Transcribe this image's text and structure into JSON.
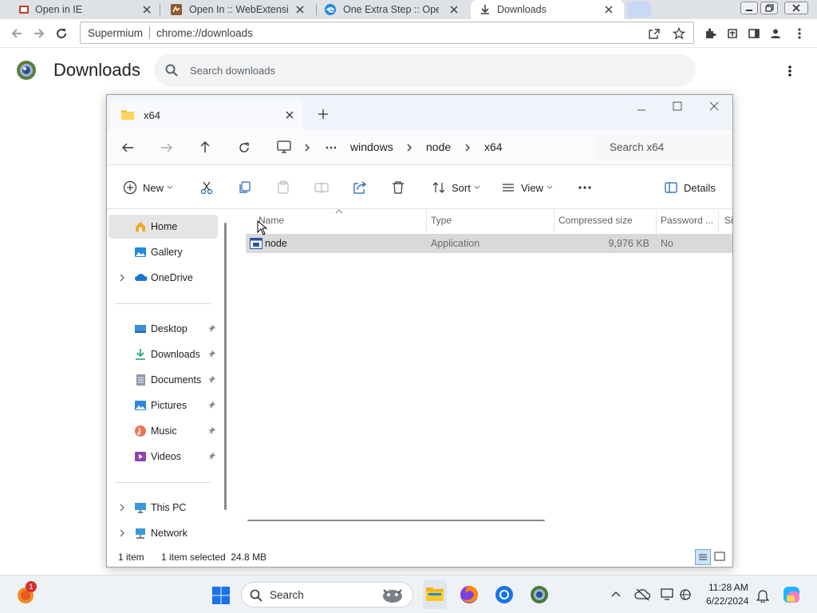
{
  "browser": {
    "tabs": [
      {
        "title": "Open in IE",
        "icon": "ie-extension-icon"
      },
      {
        "title": "Open In :: WebExtensions",
        "icon": "addon-icon"
      },
      {
        "title": "One Extra Step :: Open",
        "icon": "edge-icon"
      },
      {
        "title": "Downloads",
        "icon": "download-icon"
      }
    ],
    "omnibox": {
      "site_label": "Supermium",
      "url": "chrome://downloads"
    }
  },
  "downloads_page": {
    "title": "Downloads",
    "search_placeholder": "Search downloads"
  },
  "explorer": {
    "tab_title": "x64",
    "breadcrumb": [
      "windows",
      "node",
      "x64"
    ],
    "search_placeholder": "Search x64",
    "commands": {
      "new": "New",
      "sort": "Sort",
      "view": "View",
      "details": "Details"
    },
    "nav": {
      "top": [
        {
          "label": "Home",
          "icon": "home-icon",
          "selected": true
        },
        {
          "label": "Gallery",
          "icon": "gallery-icon"
        },
        {
          "label": "OneDrive",
          "icon": "onedrive-icon"
        }
      ],
      "quick": [
        {
          "label": "Desktop",
          "icon": "desktop-icon"
        },
        {
          "label": "Downloads",
          "icon": "downloads-folder-icon"
        },
        {
          "label": "Documents",
          "icon": "documents-icon"
        },
        {
          "label": "Pictures",
          "icon": "pictures-icon"
        },
        {
          "label": "Music",
          "icon": "music-icon"
        },
        {
          "label": "Videos",
          "icon": "videos-icon"
        }
      ],
      "bottom": [
        {
          "label": "This PC",
          "icon": "this-pc-icon"
        },
        {
          "label": "Network",
          "icon": "network-icon"
        }
      ]
    },
    "columns": [
      "Name",
      "Type",
      "Compressed size",
      "Password ...",
      "Si"
    ],
    "files": [
      {
        "name": "node",
        "type": "Application",
        "compressed_size": "9,976 KB",
        "password": "No"
      }
    ],
    "status": {
      "count": "1 item",
      "selected": "1 item selected  24.8 MB"
    }
  },
  "taskbar": {
    "search_label": "Search",
    "time": "11:28 AM",
    "date": "6/22/2024",
    "notification_badge": "1"
  }
}
